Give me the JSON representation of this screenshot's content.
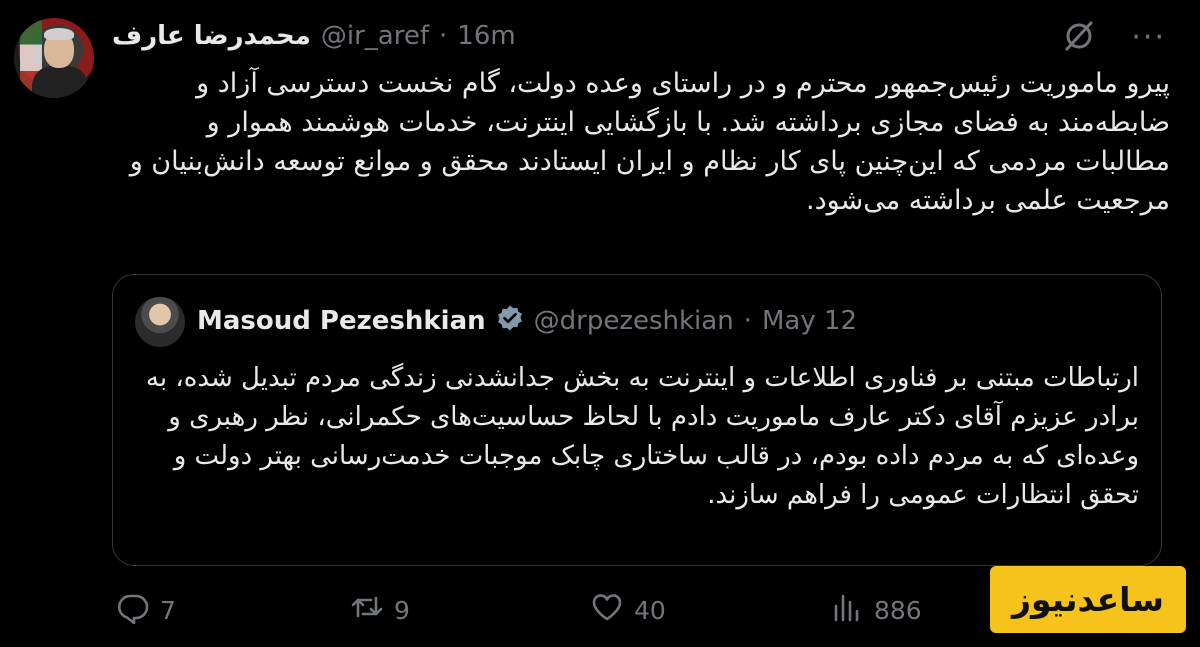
{
  "author": {
    "display_name": "محمدرضا عارف",
    "handle": "@ir_aref",
    "separator": "·",
    "time": "16m"
  },
  "tweet_text": "پیرو ماموریت رئیس‌جمهور محترم و در راستای وعده دولت، گام نخست دسترسی آزاد و ضابطه‌مند به فضای مجازی برداشته شد. با بازگشایی اینترنت، خدمات هوشمند هموار و مطالبات مردمی که این‌چنین پای کار نظام و ایران ایستادند محقق و موانع توسعه دانش‌بنیان و مرجعیت علمی برداشته می‌شود.",
  "quoted": {
    "display_name": "Masoud Pezeshkian",
    "handle": "@drpezeshkian",
    "separator": "·",
    "date": "May 12",
    "text": "ارتباطات مبتنی بر فناوری اطلاعات و اینترنت به بخش جدانشدنی زندگی مردم تبدیل شده، به برادر عزیزم آقای دکتر عارف ماموریت دادم با لحاظ حساسیت‌های حکمرانی، نظر رهبری و وعده‌ای که به مردم داده بودم، در قالب ساختاری چابک موجبات خدمت‌رسانی بهتر دولت و تحقق انتظارات عمومی را فراهم سازند."
  },
  "actions": {
    "replies": "7",
    "reposts": "9",
    "likes": "40",
    "views": "886"
  },
  "watermark": "ساعدنیوز",
  "icons": [
    "grok-icon",
    "more-icon",
    "verified-badge-icon",
    "reply-icon",
    "repost-icon",
    "like-icon",
    "views-icon"
  ],
  "colors": {
    "background": "#000000",
    "text": "#e7e9ea",
    "muted": "#71767b",
    "verified": "#829aab",
    "watermark_bg": "#f6c21c"
  }
}
